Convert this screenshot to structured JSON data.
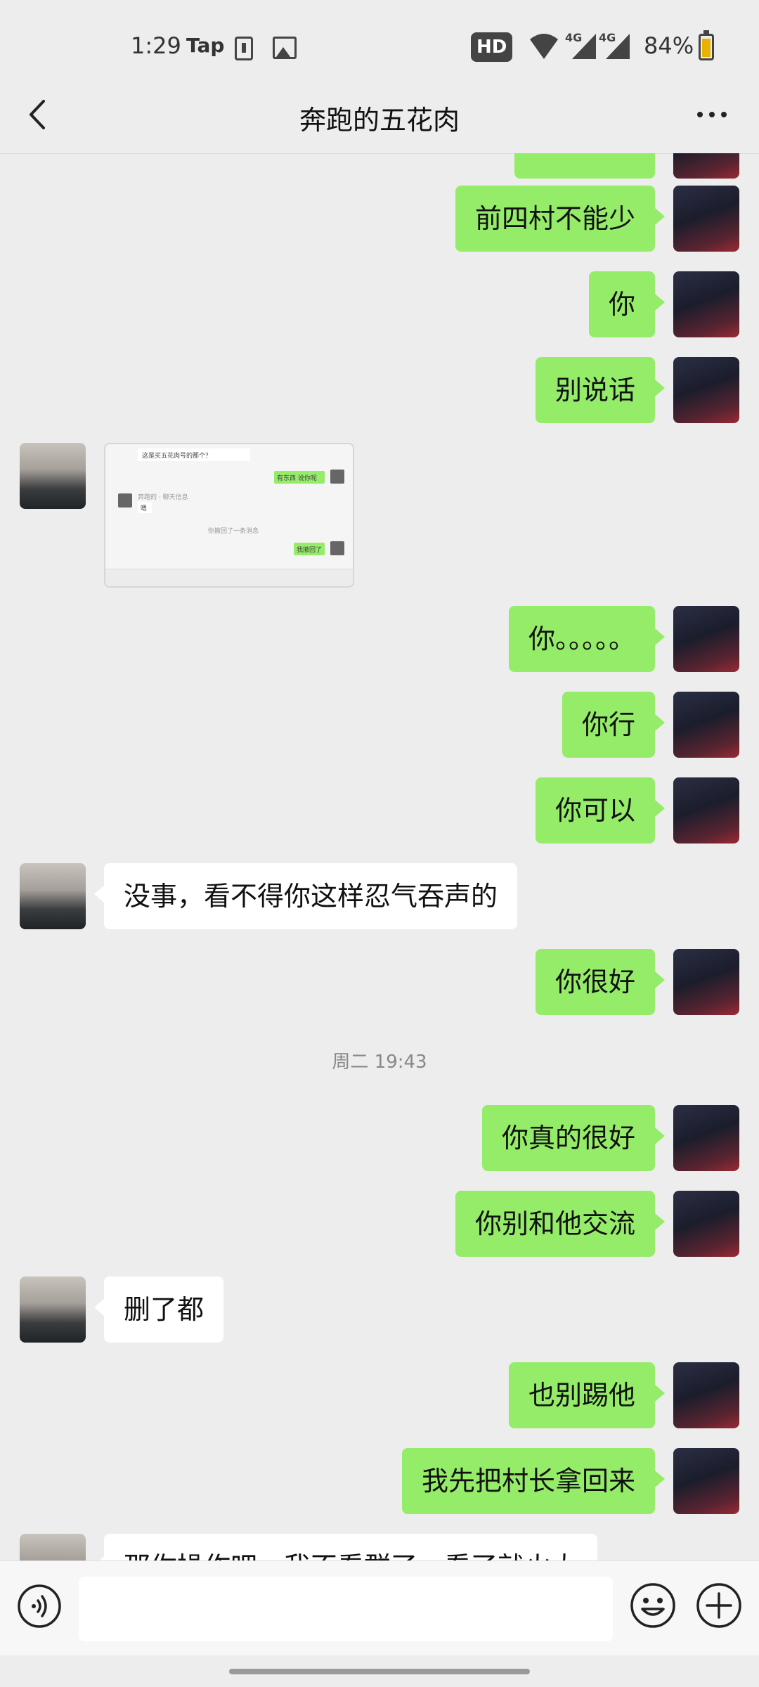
{
  "status_bar": {
    "time": "1:29",
    "app_label": "Tap",
    "hd_badge": "HD",
    "network_1": "4G",
    "network_2": "4G",
    "battery": "84%"
  },
  "header": {
    "title": "奔跑的五花肉"
  },
  "messages": [
    {
      "sender": "me",
      "text": "前四村不能少"
    },
    {
      "sender": "me",
      "text": "你"
    },
    {
      "sender": "me",
      "text": "别说话"
    },
    {
      "sender": "them",
      "type": "image",
      "image_texts": {
        "line1": "这是买五花肉号的那个？",
        "reply1": "有东西 说你呢",
        "name": "奔跑的 · 聊天信息",
        "reply2": "嗯",
        "system": "你撤回了一条消息",
        "reply3": "我撤回了"
      }
    },
    {
      "sender": "me",
      "text": "你。。。。。"
    },
    {
      "sender": "me",
      "text": "你行"
    },
    {
      "sender": "me",
      "text": "你可以"
    },
    {
      "sender": "them",
      "text": "没事，看不得你这样忍气吞声的"
    },
    {
      "sender": "me",
      "text": "你很好"
    },
    {
      "type": "time",
      "text": "周二 19:43"
    },
    {
      "sender": "me",
      "text": "你真的很好"
    },
    {
      "sender": "me",
      "text": "你别和他交流"
    },
    {
      "sender": "them",
      "text": "删了都"
    },
    {
      "sender": "me",
      "text": "也别踢他"
    },
    {
      "sender": "me",
      "text": "我先把村长拿回来"
    },
    {
      "sender": "them",
      "text": "那你操作吧，我不看群了，看了就火大"
    }
  ],
  "input_bar": {
    "placeholder": ""
  },
  "colors": {
    "my_bubble": "#95ec69",
    "their_bubble": "#ffffff",
    "background": "#ededed"
  },
  "icons": [
    "back-icon",
    "more-icon",
    "voice-icon",
    "emoji-icon",
    "plus-icon"
  ]
}
